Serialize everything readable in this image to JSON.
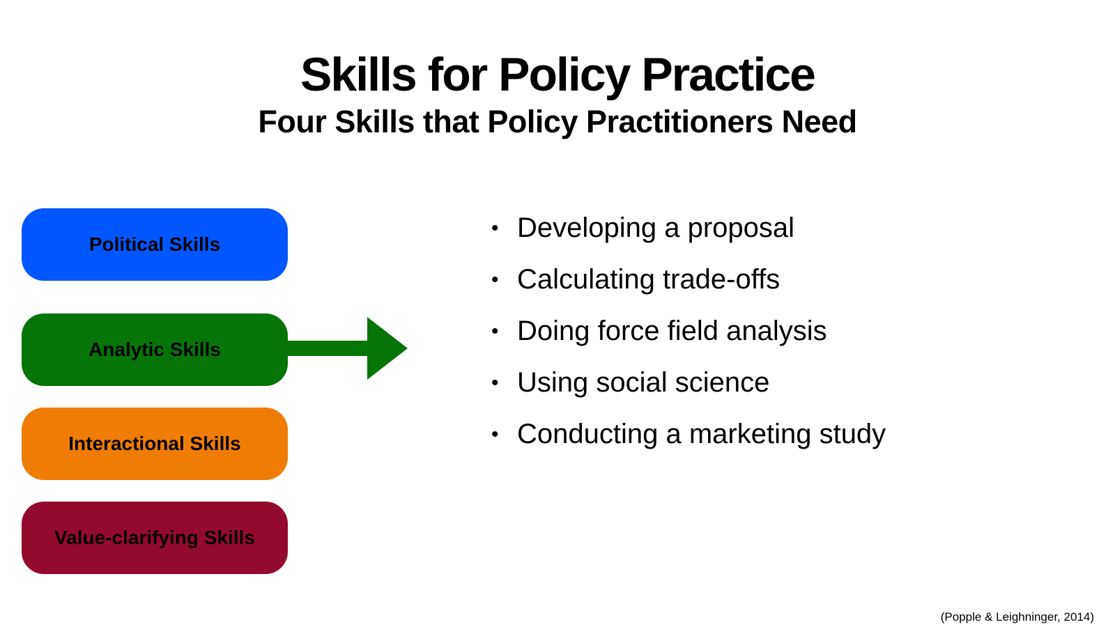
{
  "slide": {
    "title": "Skills for Policy Practice",
    "subtitle": "Four Skills that Policy Practitioners Need",
    "citation": "(Popple & Leighninger, 2014)"
  },
  "skills": [
    {
      "label": "Political Skills",
      "color": "#0057FF"
    },
    {
      "label": "Analytic Skills",
      "color": "#077407"
    },
    {
      "label": "Interactional Skills",
      "color": "#F07C05"
    },
    {
      "label": "Value-clarifying Skills",
      "color": "#940A2E"
    }
  ],
  "arrow": {
    "color": "#077407",
    "icon": "right-arrow-icon"
  },
  "bullets": {
    "marker": "•",
    "items": [
      "Developing a proposal",
      "Calculating trade-offs",
      "Doing force field analysis",
      "Using social science",
      "Conducting a marketing study"
    ]
  }
}
